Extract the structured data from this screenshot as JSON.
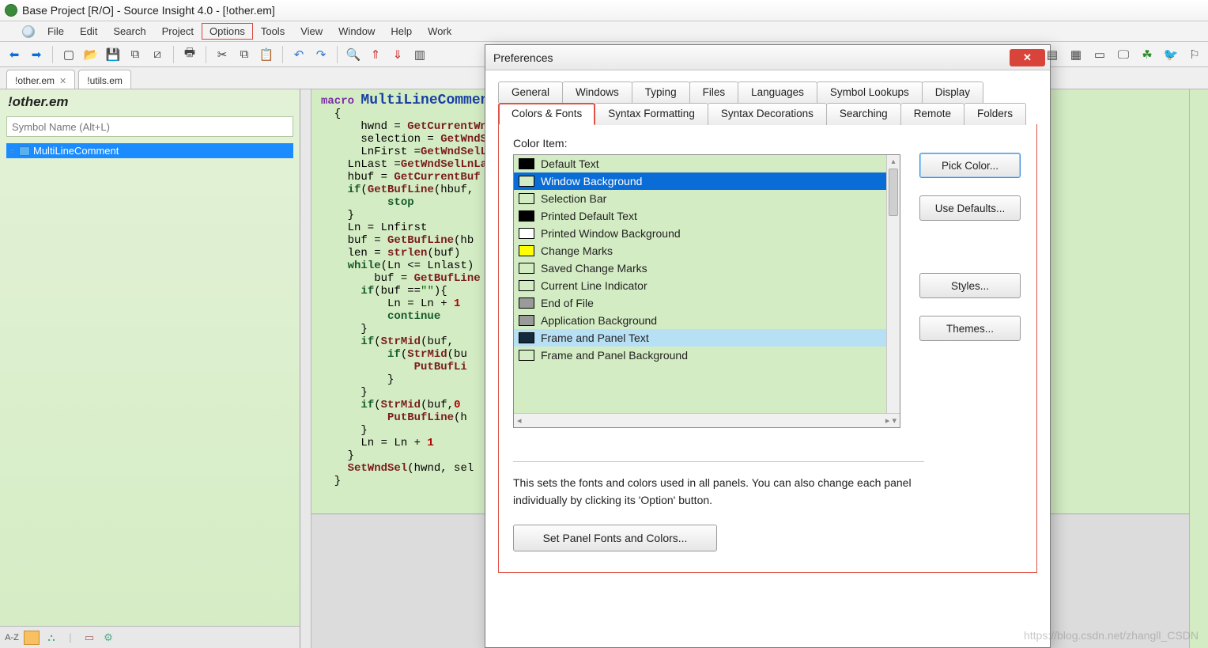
{
  "title": "Base Project [R/O] - Source Insight 4.0 - [!other.em]",
  "menu": [
    "File",
    "Edit",
    "Search",
    "Project",
    "Options",
    "Tools",
    "View",
    "Window",
    "Help",
    "Work"
  ],
  "menu_highlight": "Options",
  "doc_tabs": [
    {
      "label": "!other.em",
      "closable": true
    },
    {
      "label": "!utils.em",
      "closable": false
    }
  ],
  "sidebar": {
    "title": "!other.em",
    "placeholder": "Symbol Name (Alt+L)",
    "items": [
      "MultiLineComment"
    ],
    "selected_index": 0,
    "statusbar_icons": [
      "A-Z",
      "list-icon",
      "hierarchy-icon",
      "book-icon",
      "gear-icon"
    ]
  },
  "editor": {
    "macro_kw": "macro",
    "fn": "MultiLineCommen",
    "lines": [
      "{",
      "    hwnd = GetCurrentWnd",
      "    selection = GetWndSe",
      "    LnFirst =GetWndSelLn",
      "  LnLast =GetWndSelLnLa",
      "  hbuf = GetCurrentBuf",
      "  if(GetBufLine(hbuf,",
      "        stop",
      "  }",
      "  Ln = Lnfirst",
      "  buf = GetBufLine(hb",
      "  len = strlen(buf)",
      "  while(Ln <= Lnlast)",
      "      buf = GetBufLine",
      "    if(buf ==\"\"){",
      "        Ln = Ln + 1",
      "        continue",
      "    }",
      "    if(StrMid(buf, ",
      "        if(StrMid(bu",
      "            PutBufLi",
      "        }",
      "    }",
      "    if(StrMid(buf,0",
      "        PutBufLine(h",
      "    }",
      "    Ln = Ln + 1",
      "  }",
      "  SetWndSel(hwnd, sel",
      "}"
    ]
  },
  "dialog": {
    "title": "Preferences",
    "tabs_row1": [
      "General",
      "Windows",
      "Typing",
      "Files",
      "Languages",
      "Symbol Lookups",
      "Display"
    ],
    "tabs_row2": [
      "Colors & Fonts",
      "Syntax Formatting",
      "Syntax Decorations",
      "Searching",
      "Remote",
      "Folders"
    ],
    "active_tab": "Colors & Fonts",
    "color_item_label": "Color Item:",
    "color_items": [
      {
        "name": "Default Text",
        "color": "#000000"
      },
      {
        "name": "Window Background",
        "color": "#d4ecc4"
      },
      {
        "name": "Selection Bar",
        "color": "#d4ecc4"
      },
      {
        "name": "Printed Default Text",
        "color": "#000000"
      },
      {
        "name": "Printed Window Background",
        "color": "#ffffff"
      },
      {
        "name": "Change Marks",
        "color": "#ffff00"
      },
      {
        "name": "Saved Change Marks",
        "color": "#d4ecc4"
      },
      {
        "name": "Current Line Indicator",
        "color": "#d4ecc4"
      },
      {
        "name": "End of File",
        "color": "#9a9a9a"
      },
      {
        "name": "Application Background",
        "color": "#9a9a9a"
      },
      {
        "name": "Frame and Panel Text",
        "color": "#142a3d"
      },
      {
        "name": "Frame and Panel Background",
        "color": "#d4ecc4"
      }
    ],
    "selected_color_index": 1,
    "hover_color_index": 10,
    "buttons": {
      "pick": "Pick Color...",
      "defaults": "Use Defaults...",
      "styles": "Styles...",
      "themes": "Themes..."
    },
    "description": "This sets the fonts and colors used in all panels. You can also change each panel individually by clicking its 'Option' button.",
    "panel_button": "Set Panel Fonts and Colors..."
  },
  "watermark": "https://blog.csdn.net/zhangll_CSDN"
}
